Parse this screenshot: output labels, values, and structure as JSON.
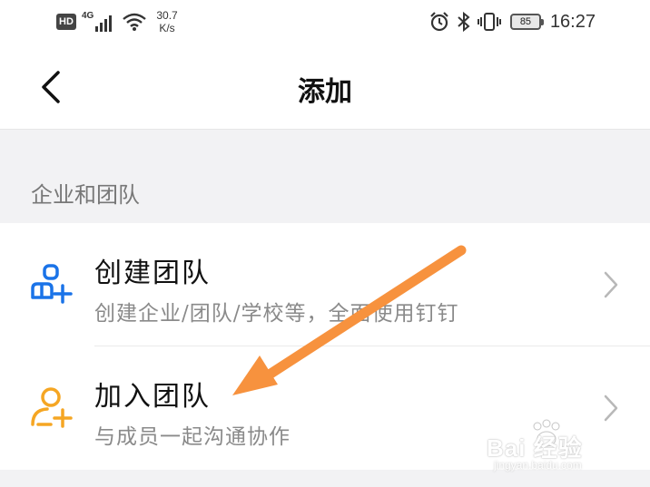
{
  "status_bar": {
    "hd": "HD",
    "network": "4G",
    "speed_value": "30.7",
    "speed_unit": "K/s",
    "battery_level": "85",
    "time": "16:27",
    "icons": [
      "signal-icon",
      "wifi-icon",
      "alarm-icon",
      "bluetooth-icon",
      "vibrate-icon",
      "battery-icon"
    ]
  },
  "navbar": {
    "title": "添加",
    "back_icon": "chevron-left-icon"
  },
  "section": {
    "title": "企业和团队"
  },
  "items": [
    {
      "title": "创建团队",
      "subtitle": "创建企业/团队/学校等，全面使用钉钉",
      "icon": "create-team-icon",
      "icon_color": "#1a73e8"
    },
    {
      "title": "加入团队",
      "subtitle": "与成员一起沟通协作",
      "icon": "join-team-icon",
      "icon_color": "#f5a623"
    }
  ],
  "annotation": {
    "arrow_color": "#f7923e"
  },
  "watermark": {
    "text": "Bai 经验",
    "sub": "jingyan.baidu.com"
  }
}
